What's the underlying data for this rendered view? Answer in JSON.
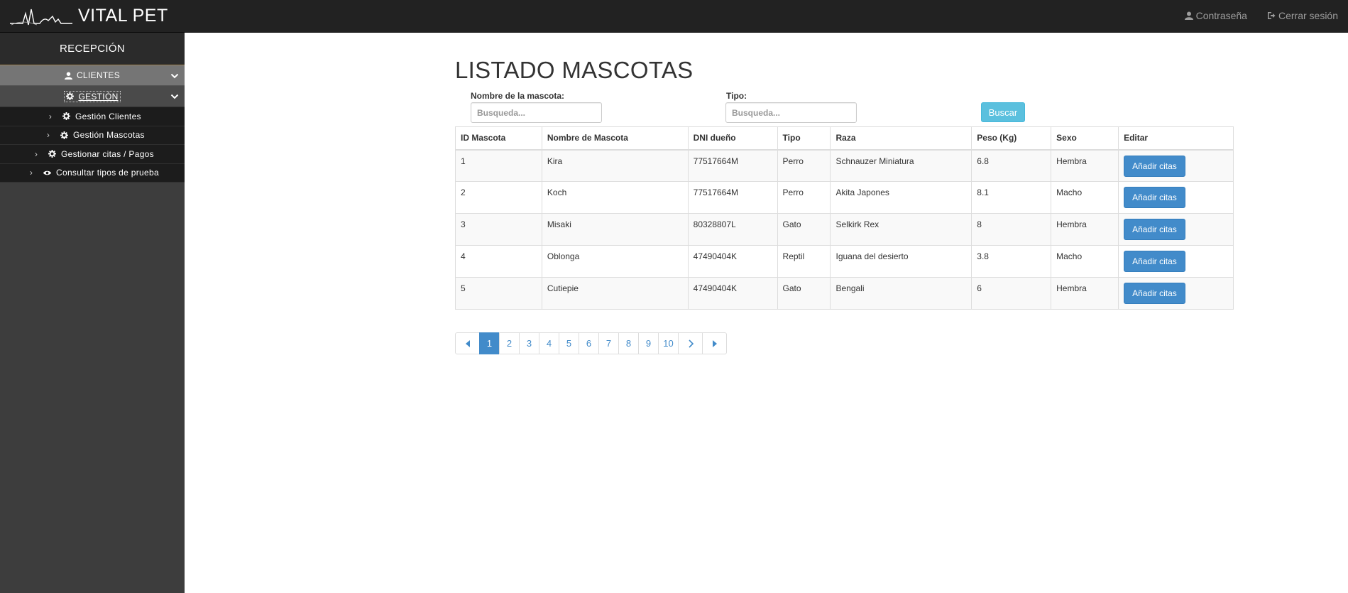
{
  "app": {
    "brand": "VITAL PET"
  },
  "navbar": {
    "password_label": "Contraseña",
    "logout_label": "Cerrar sesión"
  },
  "sidebar": {
    "header": "RECEPCIÓN",
    "clientes_label": "CLIENTES",
    "gestion_label": "GESTIÓN",
    "sub_items": [
      {
        "label": "Gestión Clientes",
        "icon": "gear-icon"
      },
      {
        "label": "Gestión Mascotas",
        "icon": "gear-icon"
      },
      {
        "label": "Gestionar citas / Pagos",
        "icon": "gear-icon"
      },
      {
        "label": "Consultar tipos de prueba",
        "icon": "eye-icon"
      }
    ]
  },
  "main": {
    "title": "LISTADO MASCOTAS",
    "filters": {
      "name_label": "Nombre de la mascota:",
      "name_placeholder": "Busqueda...",
      "type_label": "Tipo:",
      "type_placeholder": "Busqueda...",
      "search_button": "Buscar"
    },
    "table": {
      "headers": [
        "ID Mascota",
        "Nombre de Mascota",
        "DNI dueño",
        "Tipo",
        "Raza",
        "Peso (Kg)",
        "Sexo",
        "Editar"
      ],
      "action_label": "Añadir citas",
      "rows": [
        [
          "1",
          "Kira",
          "77517664M",
          "Perro",
          "Schnauzer Miniatura",
          "6.8",
          "Hembra"
        ],
        [
          "2",
          "Koch",
          "77517664M",
          "Perro",
          "Akita Japones",
          "8.1",
          "Macho"
        ],
        [
          "3",
          "Misaki",
          "80328807L",
          "Gato",
          "Selkirk Rex",
          "8",
          "Hembra"
        ],
        [
          "4",
          "Oblonga",
          "47490404K",
          "Reptil",
          "Iguana del desierto",
          "3.8",
          "Macho"
        ],
        [
          "5",
          "Cutiepie",
          "47490404K",
          "Gato",
          "Bengali",
          "6",
          "Hembra"
        ]
      ]
    },
    "pagination": {
      "pages": [
        "1",
        "2",
        "3",
        "4",
        "5",
        "6",
        "7",
        "8",
        "9",
        "10"
      ],
      "current": "1"
    }
  },
  "colors": {
    "navbar_bg": "#222222",
    "sidebar_bg": "#3d3d3d",
    "primary": "#428bca",
    "info": "#5bc0de"
  }
}
